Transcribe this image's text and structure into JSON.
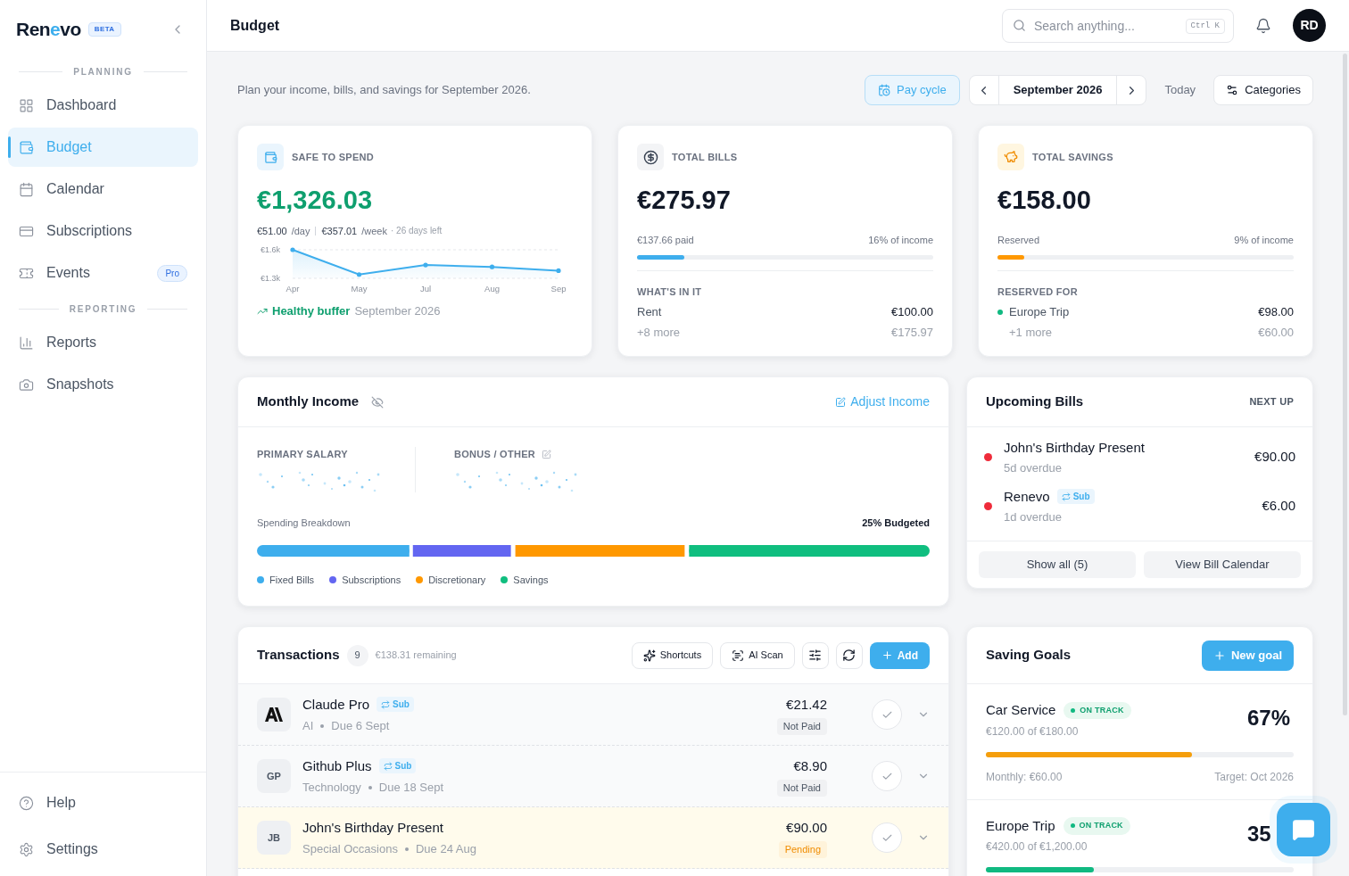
{
  "sidebar": {
    "logo": [
      "Ren",
      "e",
      "vo"
    ],
    "badge": "BETA",
    "sections": [
      {
        "title": "PLANNING",
        "items": [
          {
            "label": "Dashboard",
            "selected": false
          },
          {
            "label": "Budget",
            "selected": true
          },
          {
            "label": "Calendar",
            "selected": false
          },
          {
            "label": "Subscriptions",
            "selected": false
          },
          {
            "label": "Events",
            "selected": false,
            "badge": "Pro"
          }
        ]
      },
      {
        "title": "REPORTING",
        "items": [
          {
            "label": "Reports",
            "selected": false
          },
          {
            "label": "Snapshots",
            "selected": false
          }
        ]
      }
    ],
    "footer": [
      {
        "label": "Help"
      },
      {
        "label": "Settings"
      }
    ]
  },
  "header": {
    "title": "Budget",
    "search": {
      "placeholder": "Search anything...",
      "shortcut": "Ctrl K"
    },
    "avatar": "RD"
  },
  "toolbar": {
    "subtitle": "Plan your income, bills, and savings for September 2026.",
    "pay_cycle": {
      "label": "Pay cycle",
      "active": true
    },
    "month": "September 2026",
    "today": "Today",
    "categories": "Categories"
  },
  "safe_to_spend": {
    "title": "SAFE TO SPEND",
    "amount": "€1,326.03",
    "per_day": "€51.00",
    "per_day_unit": "/day",
    "per_week": "€357.01",
    "per_week_unit": "/week",
    "days_left": "· 26 days left",
    "trend": "Healthy buffer",
    "trend_period": "September 2026",
    "chart_data": {
      "type": "area",
      "categories": [
        "Apr",
        "May",
        "Jul",
        "Aug",
        "Sep"
      ],
      "series": [
        {
          "color": "#3eaeed",
          "values": [
            1600,
            1340,
            1440,
            1420,
            1380
          ]
        }
      ],
      "ylim": [
        1300,
        1600
      ],
      "yticks": [
        {
          "value": 1600,
          "label": "€1.6k"
        },
        {
          "value": 1300,
          "label": "€1.3k"
        }
      ]
    }
  },
  "total_bills": {
    "title": "TOTAL BILLS",
    "amount": "€275.97",
    "paid": "€137.66 paid",
    "share": "16% of income",
    "level": 0.16,
    "section": "WHAT'S IN IT",
    "items": [
      {
        "label": "Rent",
        "amount": "€100.00",
        "muted": false
      },
      {
        "label": "+8 more",
        "amount": "€175.97",
        "muted": true
      }
    ]
  },
  "total_savings": {
    "title": "TOTAL SAVINGS",
    "amount": "€158.00",
    "reserved": "Reserved",
    "share": "9% of income",
    "level": 0.09,
    "section": "RESERVED FOR",
    "items": [
      {
        "label": "Europe Trip",
        "amount": "€98.00",
        "muted": false,
        "color": "#10b981"
      },
      {
        "label": "+1 more",
        "amount": "€60.00",
        "muted": true
      }
    ]
  },
  "income": {
    "title": "Monthly Income",
    "adjust": "Adjust Income",
    "sources": [
      {
        "label": "PRIMARY SALARY",
        "editable": false
      },
      {
        "label": "BONUS / OTHER",
        "editable": true
      }
    ],
    "breakdown_label": "Spending Breakdown",
    "budgeted": "25% Budgeted",
    "legend": [
      {
        "label": "Fixed Bills",
        "color": "#3eaeed"
      },
      {
        "label": "Subscriptions",
        "color": "#6366f1"
      },
      {
        "label": "Discretionary",
        "color": "#ff9800"
      },
      {
        "label": "Savings",
        "color": "#10be7f"
      }
    ]
  },
  "upcoming_bills": {
    "title": "Upcoming Bills",
    "tag": "NEXT UP",
    "items": [
      {
        "name": "John's Birthday Present",
        "due": "5d overdue",
        "amount": "€90.00",
        "color": "#ef2b3a"
      },
      {
        "name": "Renevo",
        "sub": "Sub",
        "due": "1d overdue",
        "amount": "€6.00",
        "color": "#ef2b3a"
      }
    ],
    "buttons": [
      "Show all (5)",
      "View Bill Calendar"
    ]
  },
  "transactions": {
    "title": "Transactions",
    "count": "9",
    "remaining": "€138.31 remaining",
    "shortcuts": "Shortcuts",
    "scan": "AI Scan",
    "add": "Add",
    "rows": [
      {
        "kind": "logo",
        "name": "Claude Pro",
        "sub": "Sub",
        "category": "AI",
        "due": "Due 6 Sept",
        "amount": "€21.42",
        "status": "Not Paid",
        "pending": false
      },
      {
        "kind": "initials",
        "initials": "GP",
        "name": "Github Plus",
        "sub": "Sub",
        "category": "Technology",
        "due": "Due 18 Sept",
        "amount": "€8.90",
        "status": "Not Paid",
        "pending": false
      },
      {
        "kind": "initials",
        "initials": "JB",
        "name": "John's Birthday Present",
        "category": "Special Occasions",
        "due": "Due 24 Aug",
        "amount": "€90.00",
        "status": "Pending",
        "pending": true
      }
    ]
  },
  "saving_goals": {
    "title": "Saving Goals",
    "new": "New goal",
    "items": [
      {
        "name": "Car Service",
        "status": "ON TRACK",
        "saved": "€120.00 of €180.00",
        "percent": "67%",
        "level": 0.67,
        "color": "#f59e0b",
        "monthly": "Monthly: €60.00",
        "target": "Target: Oct 2026"
      },
      {
        "name": "Europe Trip",
        "status": "ON TRACK",
        "saved": "€420.00 of €1,200.00",
        "percent": "35",
        "level": 0.35,
        "color": "#10b981"
      }
    ]
  }
}
